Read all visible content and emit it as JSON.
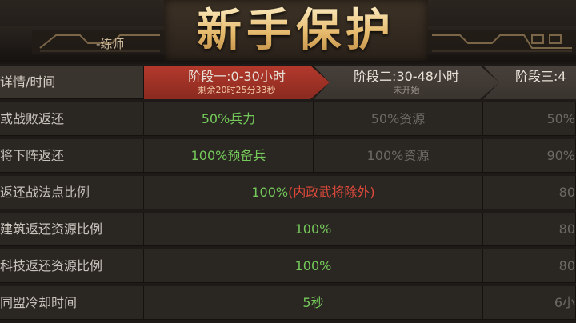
{
  "header": {
    "title": "新手保护",
    "tab_label": "-练师"
  },
  "table": {
    "columns": {
      "detail_time": "详情/时间",
      "stage1": {
        "name": "阶段一:0-30小时",
        "sub": "剩余20时25分33秒"
      },
      "stage2": {
        "name": "阶段二:30-48小时",
        "sub": "未开始"
      },
      "stage3": {
        "name": "阶段三:4"
      }
    },
    "rows": [
      {
        "label": "或战败返还",
        "stage1": "50%兵力",
        "stage2": "50%资源",
        "stage3": "50%"
      },
      {
        "label": "将下阵返还",
        "stage1": "100%预备兵",
        "stage2": "100%资源",
        "stage3": "90%"
      },
      {
        "label": "返还战法点比例",
        "merged_main": "100%",
        "merged_note": "(内政武将除外)",
        "stage3": "80"
      },
      {
        "label": "建筑返还资源比例",
        "merged_main": "100%",
        "stage3": "80"
      },
      {
        "label": "科技返还资源比例",
        "merged_main": "100%",
        "stage3": "80"
      },
      {
        "label": "同盟冷却时间",
        "merged_main": "5秒",
        "stage3": "6小"
      }
    ]
  },
  "colors": {
    "active_stage": "#b4392c",
    "value_green": "#74c95a",
    "value_gray": "#6c6862",
    "note_red": "#e04a3b",
    "title_gold": "#e5b96b"
  }
}
